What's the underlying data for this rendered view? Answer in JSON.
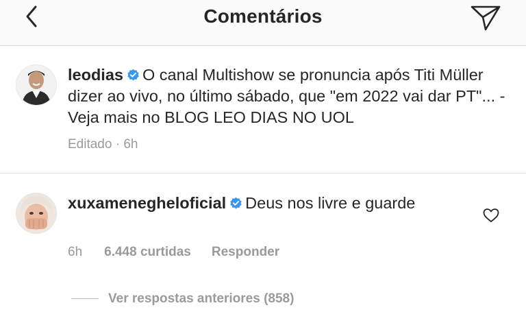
{
  "header": {
    "title": "Comentários",
    "back_icon": "chevron-left-icon",
    "send_icon": "paper-plane-icon"
  },
  "caption": {
    "username": "leodias",
    "text": "O canal Multishow se pronuncia após Titi Müller dizer ao vivo, no último sábado, que \"em 2022 vai dar PT\"... - Veja mais no BLOG LEO DIAS NO UOL",
    "meta": "Editado · 6h",
    "verified_color": "#3897f0"
  },
  "comment": {
    "username": "xuxamenegheloficial",
    "text": "Deus nos livre e guarde",
    "time": "6h",
    "likes": "6.448 curtidas",
    "reply_label": "Responder",
    "view_replies": "Ver respostas anteriores (858)"
  }
}
